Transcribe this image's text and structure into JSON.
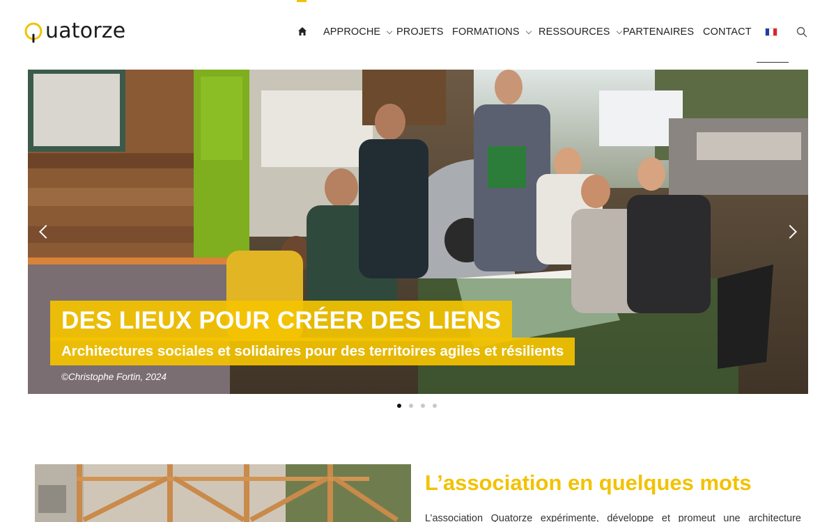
{
  "header": {
    "logo_text": "uatorze",
    "logo_alt": "Quatorze",
    "nav": [
      {
        "label": "APPROCHE",
        "has_dropdown": true
      },
      {
        "label": "PROJETS",
        "has_dropdown": false
      },
      {
        "label": "FORMATIONS",
        "has_dropdown": true
      },
      {
        "label": "RESSOURCES",
        "has_dropdown": true
      },
      {
        "label": "PARTENAIRES",
        "has_dropdown": false
      },
      {
        "label": "CONTACT",
        "has_dropdown": false
      }
    ],
    "icons": {
      "home": "home-icon",
      "language": "french-flag-icon",
      "search": "search-icon"
    },
    "accent_color": "#f2c200"
  },
  "hero": {
    "title": "DES LIEUX POUR CRÉER DES LIENS",
    "subtitle": "Architectures sociales et solidaires pour des territoires agiles et résilients",
    "credit": "©Christophe Fortin, 2024",
    "slide_count": 4,
    "active_slide": 1
  },
  "about": {
    "heading": "L’association en quelques mots",
    "text": "L’association Quatorze expérimente, développe et promeut une architecture"
  },
  "colors": {
    "accent": "#f2c200",
    "overlay": "#f4c300",
    "text": "#222222"
  }
}
